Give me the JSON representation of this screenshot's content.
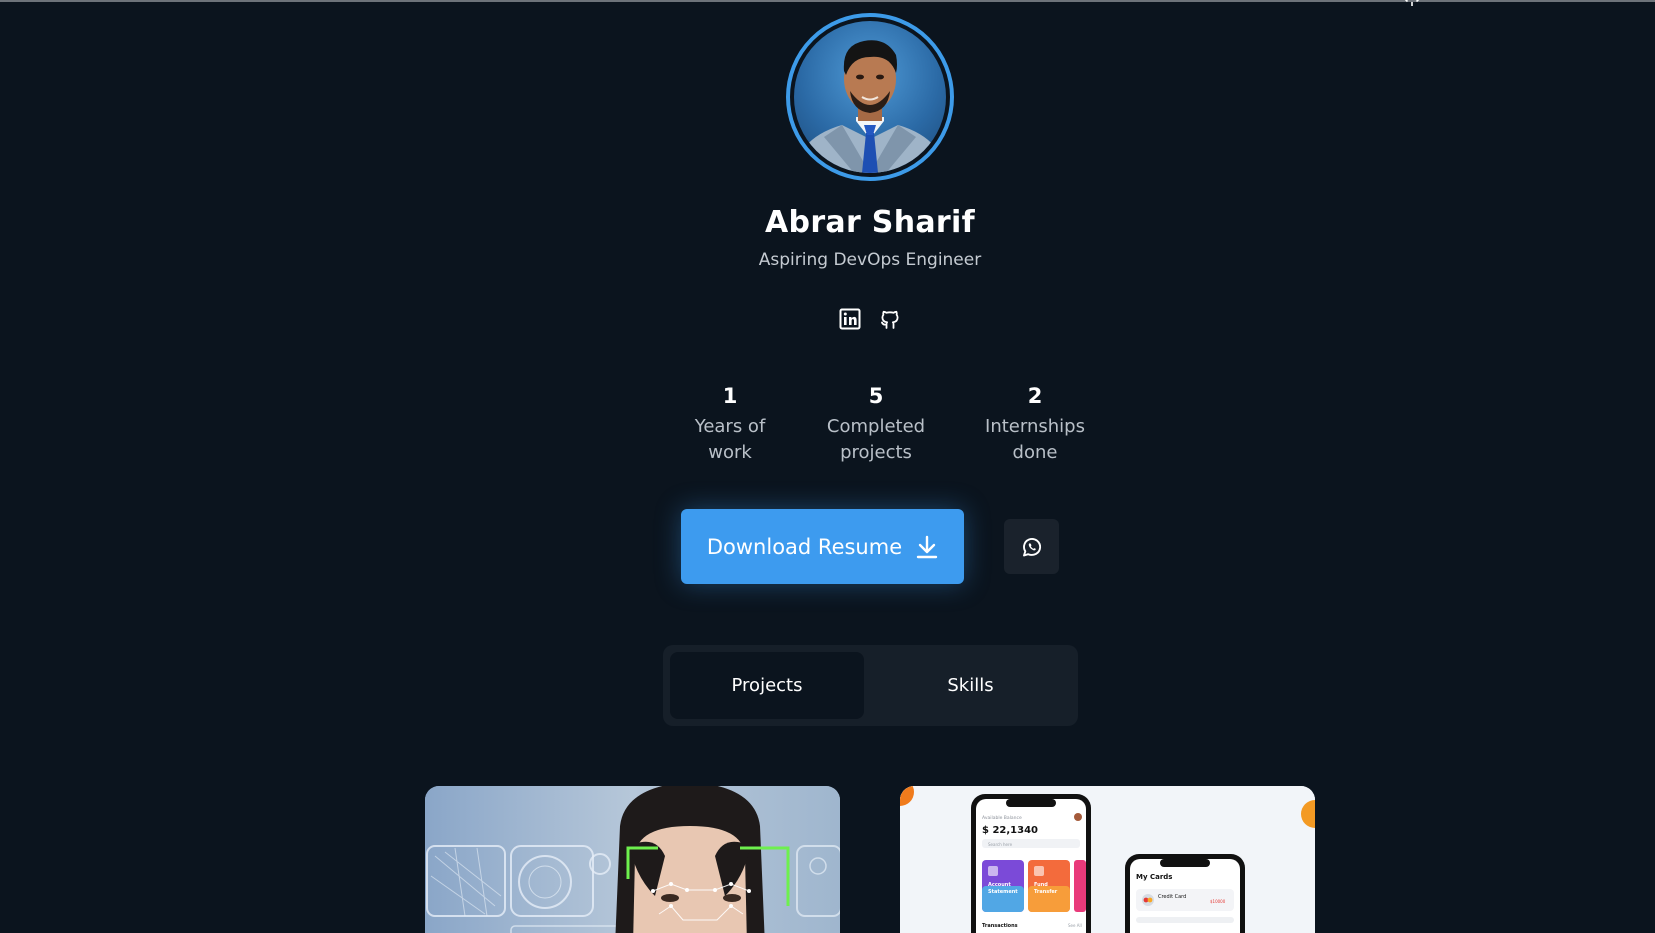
{
  "profile": {
    "name": "Abrar Sharif",
    "role": "Aspiring DevOps Engineer"
  },
  "socials": [
    {
      "icon": "linkedin-icon"
    },
    {
      "icon": "github-icon"
    }
  ],
  "stats": [
    {
      "value": "1",
      "label_line1": "Years of",
      "label_line2": "work"
    },
    {
      "value": "5",
      "label_line1": "Completed",
      "label_line2": "projects"
    },
    {
      "value": "2",
      "label_line1": "Internships",
      "label_line2": "done"
    }
  ],
  "actions": {
    "download_label": "Download Resume",
    "download_icon": "download-icon",
    "whatsapp_icon": "whatsapp-icon"
  },
  "tabs": [
    {
      "label": "Projects",
      "active": true
    },
    {
      "label": "Skills",
      "active": false
    }
  ],
  "cards": {
    "project1": {
      "kind": "face-recognition-illustration"
    },
    "project2": {
      "kind": "banking-app-mockup",
      "balance_caption": "Available Balance",
      "balance": "$ 22,1340",
      "search_placeholder": "Search here",
      "tile1_line1": "Account",
      "tile1_line2": "Statement",
      "tile2_line1": "Fund",
      "tile2_line2": "Transfer",
      "transactions_label": "Transactions",
      "see_all_label": "See All",
      "phone2_title": "My Cards",
      "credit_card_label": "Credit Card",
      "credit_card_amount": "$10000"
    }
  },
  "colors": {
    "background": "#0b141e",
    "accent": "#3d9bef",
    "surface": "#161f29",
    "muted_text": "#b9c0c8"
  }
}
